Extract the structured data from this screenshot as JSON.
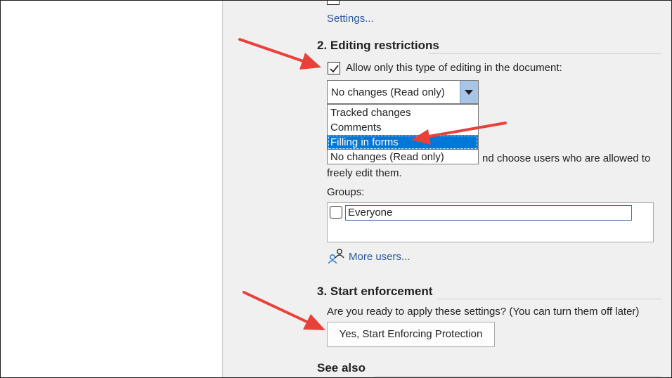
{
  "pane": {
    "settings_link": "Settings...",
    "section2": {
      "heading": "2. Editing restrictions",
      "allow_checkbox_label": "Allow only this type of editing in the document:",
      "allow_checked": true,
      "combo_value": "No changes (Read only)",
      "options": [
        "Tracked changes",
        "Comments",
        "Filling in forms",
        "No changes (Read only)"
      ],
      "highlighted_option": "Filling in forms",
      "exceptions_line1": "nd choose users who are allowed to",
      "exceptions_line2": "freely edit them.",
      "groups_label": "Groups:",
      "everyone_label": "Everyone",
      "more_users_link": "More users..."
    },
    "section3": {
      "heading": "3. Start enforcement",
      "prompt": "Are you ready to apply these settings? (You can turn them off later)",
      "enforce_button": "Yes, Start Enforcing Protection"
    },
    "see_also_heading": "See also"
  },
  "colors": {
    "accent_link": "#2b579a",
    "selection": "#0078d7",
    "annotation_arrow": "#e8413a"
  },
  "icons": [
    "checkmark-icon",
    "dropdown-arrow-icon",
    "users-icon",
    "annotation-arrow-icon"
  ]
}
